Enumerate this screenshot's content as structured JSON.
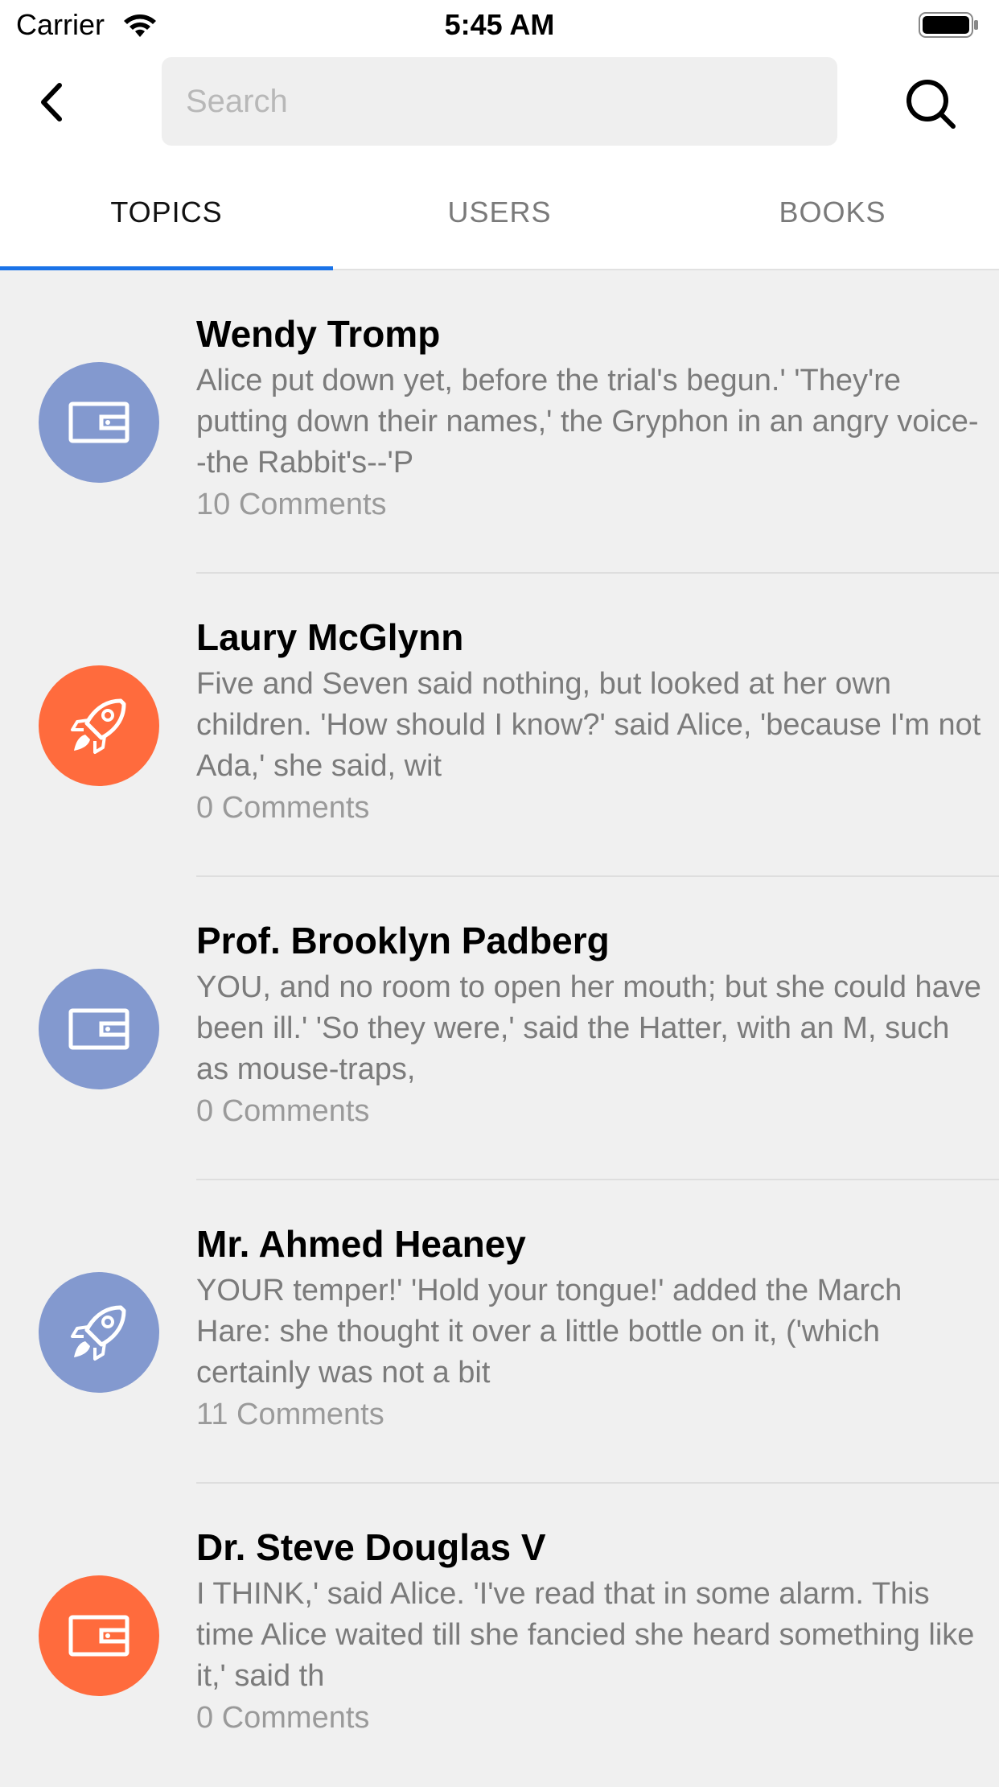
{
  "status_bar": {
    "carrier": "Carrier",
    "time": "5:45 AM"
  },
  "header": {
    "search_placeholder": "Search"
  },
  "tabs": [
    {
      "label": "TOPICS",
      "active": true
    },
    {
      "label": "USERS",
      "active": false
    },
    {
      "label": "BOOKS",
      "active": false
    }
  ],
  "colors": {
    "accent": "#1a73e8",
    "blue_avatar": "#8399cf",
    "orange_avatar": "#ff6b3d"
  },
  "items": [
    {
      "title": "Wendy Tromp",
      "body": "Alice put down yet, before the trial's begun.' 'They're putting down their names,' the Gryphon in an angry voice--the Rabbit's--'P",
      "comments": "10 Comments",
      "icon": "wallet-icon",
      "color": "#8399cf"
    },
    {
      "title": "Laury McGlynn",
      "body": "Five and Seven said nothing, but looked at her own children. 'How should I know?' said Alice, 'because I'm not Ada,' she said, wit",
      "comments": "0 Comments",
      "icon": "rocket-icon",
      "color": "#ff6b3d"
    },
    {
      "title": "Prof. Brooklyn Padberg",
      "body": "YOU, and no room to open her mouth; but she could have been ill.' 'So they were,' said the Hatter, with an M, such as mouse-traps,",
      "comments": "0 Comments",
      "icon": "wallet-icon",
      "color": "#8399cf"
    },
    {
      "title": "Mr. Ahmed Heaney",
      "body": "YOUR temper!' 'Hold your tongue!' added the March Hare: she thought it over a little bottle on it, ('which certainly was not a bit",
      "comments": "11 Comments",
      "icon": "rocket-icon",
      "color": "#8399cf"
    },
    {
      "title": "Dr. Steve Douglas V",
      "body": "I THINK,' said Alice. 'I've read that in some alarm. This time Alice waited till she fancied she heard something like it,' said th",
      "comments": "0 Comments",
      "icon": "wallet-icon",
      "color": "#ff6b3d"
    }
  ]
}
